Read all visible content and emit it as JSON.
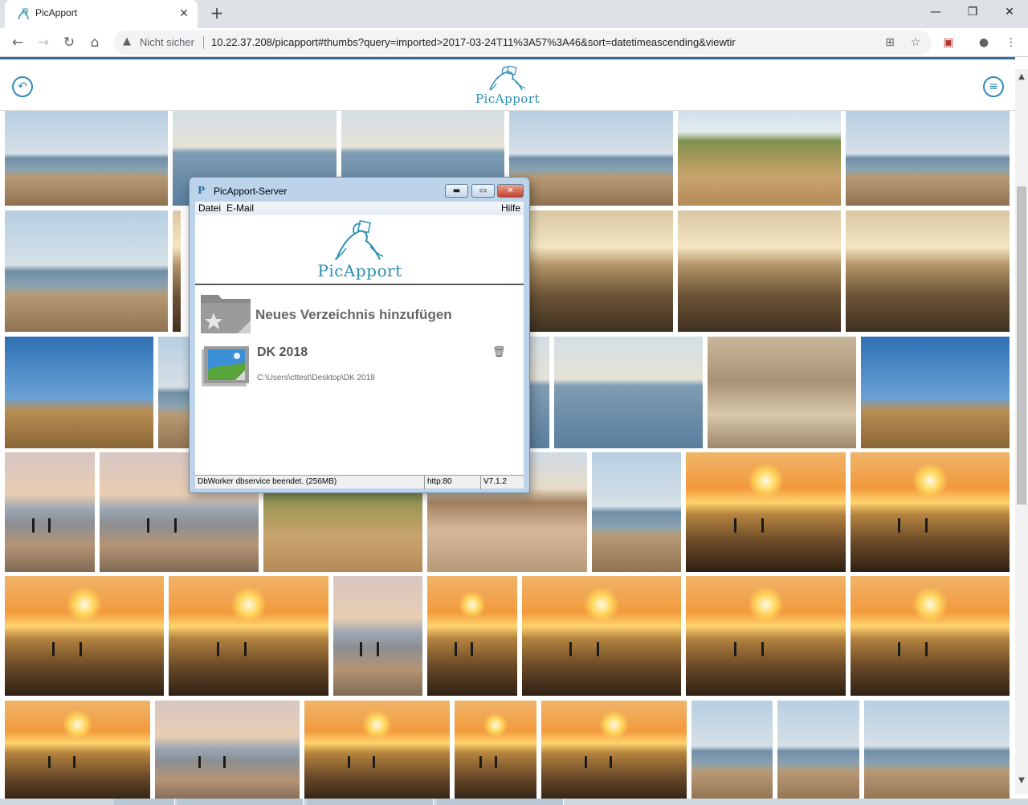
{
  "browser": {
    "tab_title": "PicApport",
    "tab_close": "✕",
    "new_tab": "+",
    "security_label": "Nicht sicher",
    "url": "10.22.37.208/picapport#thumbs?query=imported>2017-03-24T11%3A57%3A46&sort=datetimeascending&viewtir",
    "window_controls": {
      "minimize": "—",
      "restore": "❐",
      "close": "✕"
    }
  },
  "app": {
    "logo_text": "PicApport",
    "back_icon": "undo-icon",
    "menu_icon": "hamburger-menu-icon"
  },
  "dialog": {
    "title": "PicApport-Server",
    "menu": {
      "file": "Datei",
      "email": "E-Mail",
      "help": "Hilfe"
    },
    "logo_text": "PicApport",
    "add_directory_label": "Neues Verzeichnis hinzufügen",
    "directories": [
      {
        "name": "DK 2018",
        "path": "C:\\Users\\cttest\\Desktop\\DK 2018"
      }
    ],
    "status": {
      "message": "DbWorker dbservice beendet. (256MB)",
      "port": "http:80",
      "version": "V7.1.2"
    }
  },
  "colors": {
    "accent": "#2e8bb7",
    "header_rule": "#3b6f9b",
    "dialog_frame": "#bcd3ea"
  },
  "photos": [
    {
      "scene": "shore"
    },
    {
      "scene": "sea"
    },
    {
      "scene": "sea"
    },
    {
      "scene": "shore"
    },
    {
      "scene": "dunes"
    },
    {
      "scene": "shore"
    },
    {
      "scene": "shore"
    },
    {
      "scene": "stone"
    },
    {
      "scene": "stone"
    },
    {
      "scene": "stone"
    },
    {
      "scene": "stone"
    },
    {
      "scene": "sandcastle"
    },
    {
      "scene": "shore"
    },
    {
      "scene": "sea"
    },
    {
      "scene": "sea"
    },
    {
      "scene": "sand"
    },
    {
      "scene": "sandcastle"
    },
    {
      "scene": "dusk"
    },
    {
      "scene": "dusk"
    },
    {
      "scene": "dunes"
    },
    {
      "scene": "car"
    },
    {
      "scene": "shore"
    },
    {
      "scene": "sunset"
    },
    {
      "scene": "sunset"
    },
    {
      "scene": "sunset"
    },
    {
      "scene": "sunset"
    },
    {
      "scene": "dusk"
    },
    {
      "scene": "sunset"
    },
    {
      "scene": "sunset"
    },
    {
      "scene": "sunset"
    },
    {
      "scene": "sunset"
    },
    {
      "scene": "sunset"
    },
    {
      "scene": "dusk"
    },
    {
      "scene": "sunset"
    },
    {
      "scene": "sunset"
    },
    {
      "scene": "sunset"
    }
  ]
}
